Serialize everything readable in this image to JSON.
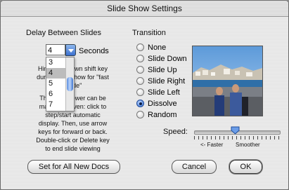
{
  "window": {
    "title": "Slide Show Settings"
  },
  "delay": {
    "heading": "Delay Between Slides",
    "selected_value": "4",
    "unit_label": "Seconds",
    "options": [
      "3",
      "4",
      "5",
      "6",
      "7"
    ],
    "selected_option": "4"
  },
  "hint_lines": [
    "Hint: Hold down shift key",
    "during slide show for \"fast",
    "mode\"",
    "",
    "The slide viewer can be",
    "manually driven: click to",
    "step/start automatic",
    "display. Then, use arrow",
    "keys for forward or back.",
    "Double-click or Delete key",
    "to end slide viewing"
  ],
  "transition": {
    "heading": "Transition",
    "options": [
      "None",
      "Slide Down",
      "Slide Up",
      "Slide Right",
      "Slide Left",
      "Dissolve",
      "Random"
    ],
    "selected": "Dissolve"
  },
  "speed": {
    "label": "Speed:",
    "faster_label": "<- Faster",
    "smoother_label": "Smoother",
    "value_fraction": 0.48
  },
  "buttons": {
    "set_all": "Set for All New Docs",
    "cancel": "Cancel",
    "ok": "OK"
  },
  "colors": {
    "accent": "#3a6fcf"
  }
}
